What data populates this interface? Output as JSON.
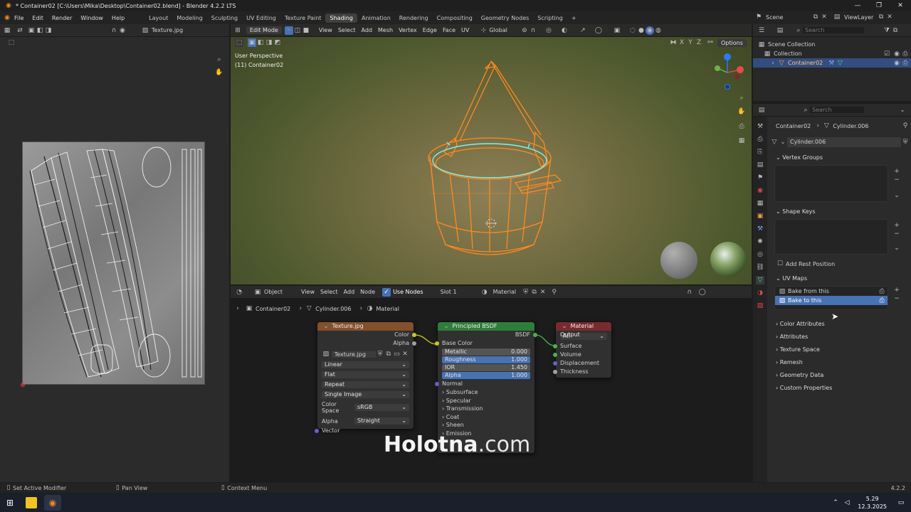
{
  "title_bar": {
    "title": "* Container02 [C:\\Users\\Mika\\Desktop\\Container02.blend] - Blender 4.2.2 LTS"
  },
  "menu": [
    "File",
    "Edit",
    "Render",
    "Window",
    "Help"
  ],
  "workspaces": [
    "Layout",
    "Modeling",
    "Sculpting",
    "UV Editing",
    "Texture Paint",
    "Shading",
    "Animation",
    "Rendering",
    "Compositing",
    "Geometry Nodes",
    "Scripting"
  ],
  "active_workspace": "Shading",
  "scene": {
    "name": "Scene",
    "view_layer": "ViewLayer"
  },
  "uv_editor": {
    "image_name": "Texture.jpg"
  },
  "viewport": {
    "mode": "Edit Mode",
    "menus": [
      "View",
      "Select",
      "Add",
      "Mesh",
      "Vertex",
      "Edge",
      "Face",
      "UV"
    ],
    "transform_orientation": "Global",
    "options_label": "Options",
    "overlay_line1": "User Perspective",
    "overlay_line2": "(11) Container02",
    "axes": [
      "X",
      "Y",
      "Z"
    ]
  },
  "node_editor": {
    "object_mode": "Object",
    "menus": [
      "View",
      "Select",
      "Add",
      "Node"
    ],
    "use_nodes_label": "Use Nodes",
    "slot": "Slot 1",
    "material": "Material",
    "breadcrumb": [
      "Container02",
      "Cylinder.006",
      "Material"
    ],
    "texture_node": {
      "title": "Texture.jpg",
      "out_color": "Color",
      "out_alpha": "Alpha",
      "image": "Texture.jpg",
      "interpolation": "Linear",
      "projection": "Flat",
      "extension": "Repeat",
      "source": "Single Image",
      "color_space_label": "Color Space",
      "color_space": "sRGB",
      "alpha_label": "Alpha",
      "alpha_mode": "Straight",
      "in_vector": "Vector"
    },
    "bsdf_node": {
      "title": "Principled BSDF",
      "out": "BSDF",
      "base_color": "Base Color",
      "metallic_label": "Metallic",
      "metallic": "0.000",
      "roughness_label": "Roughness",
      "roughness": "1.000",
      "ior_label": "IOR",
      "ior": "1.450",
      "alpha_label": "Alpha",
      "alpha": "1.000",
      "normal": "Normal",
      "subpanels": [
        "Subsurface",
        "Specular",
        "Transmission",
        "Coat",
        "Sheen",
        "Emission"
      ]
    },
    "output_node": {
      "title": "Material Output",
      "target": "All",
      "inputs": [
        "Surface",
        "Volume",
        "Displacement",
        "Thickness"
      ]
    }
  },
  "outliner": {
    "search_placeholder": "Search",
    "items": [
      "Scene Collection",
      "Collection",
      "Container02"
    ]
  },
  "properties": {
    "search_placeholder": "Search",
    "breadcrumb": [
      "Container02",
      "Cylinder.006"
    ],
    "mesh_name": "Cylinder.006",
    "panels_top": [
      "Vertex Groups",
      "Shape Keys"
    ],
    "add_rest_position": "Add Rest Position",
    "uv_maps_title": "UV Maps",
    "uv_maps": [
      "Bake from this",
      "Bake to this"
    ],
    "panels_bottom": [
      "Color Attributes",
      "Attributes",
      "Texture Space",
      "Remesh",
      "Geometry Data",
      "Custom Properties"
    ]
  },
  "status_bar": {
    "left": "Set Active Modifier",
    "middle": "Pan View",
    "right": "Context Menu",
    "version": "4.2.2"
  },
  "taskbar": {
    "time": "5.29",
    "date": "12.3.2025"
  },
  "watermark": {
    "bold": "Holotna",
    "rest": ".com"
  },
  "colors": {
    "accent": "#4772b3",
    "selection": "#ff8a1f",
    "texture_header": "#83502c",
    "bsdf_header": "#2f7d3a",
    "output_header": "#7a2a2e"
  }
}
